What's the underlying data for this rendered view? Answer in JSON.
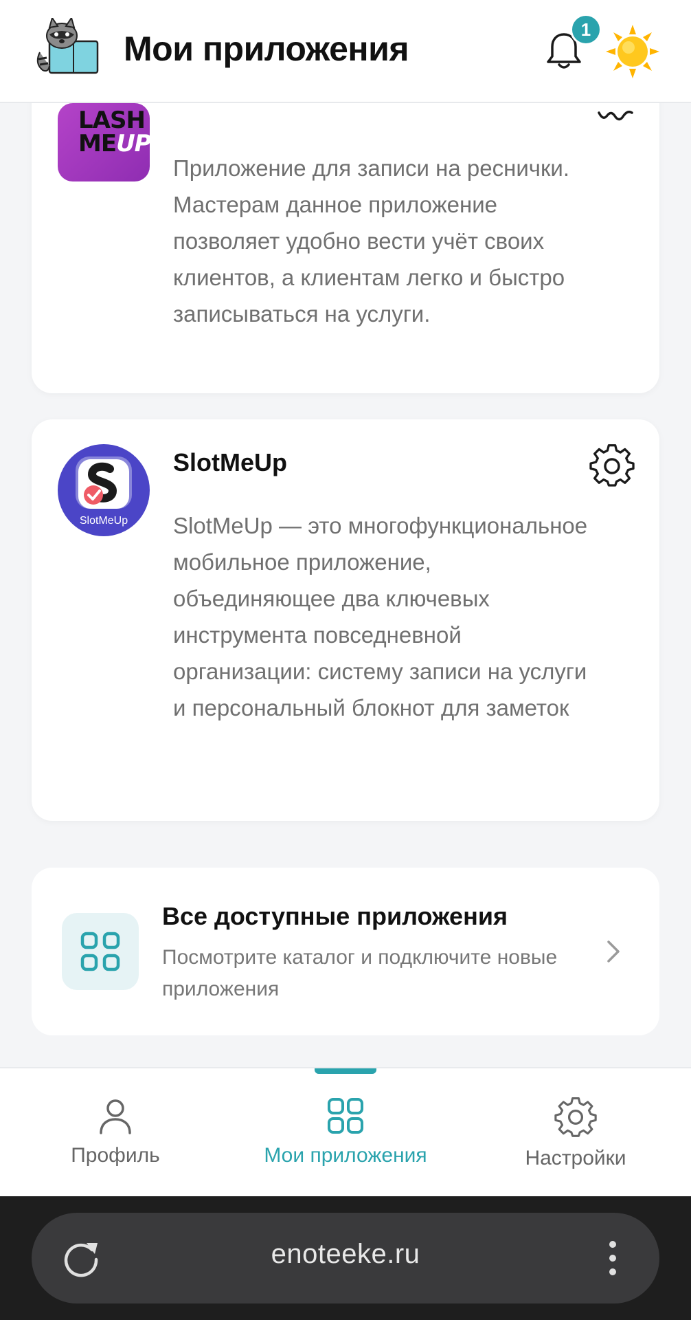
{
  "header": {
    "title": "Мои приложения",
    "notification_count": "1"
  },
  "apps": [
    {
      "name": "",
      "icon_text_line1": "LASH",
      "icon_text_line2": "ME",
      "icon_text_up": "UP",
      "description": "Приложение для записи на реснички. Мастерам данное приложение позволяет удобно вести учёт своих клиентов, а клиентам легко и быстро записываться на услуги."
    },
    {
      "name": "SlotMeUp",
      "icon_label": "SlotMeUp",
      "description": "SlotMeUp — это многофункциональное мобильное приложение, объединяющее два ключевых инструмента повседневной организации: систему записи на услуги и персональный блокнот для заметок"
    }
  ],
  "all_apps": {
    "title": "Все доступные приложения",
    "subtitle": "Посмотрите каталог и подключите новые приложения"
  },
  "nav": {
    "profile": "Профиль",
    "apps": "Мои приложения",
    "settings": "Настройки",
    "active": "apps"
  },
  "browser": {
    "url": "enoteeke.ru"
  },
  "colors": {
    "accent": "#2aa3ad",
    "background": "#f4f5f7",
    "lash_icon": "#a93bc3",
    "slot_icon": "#4b45c7"
  }
}
